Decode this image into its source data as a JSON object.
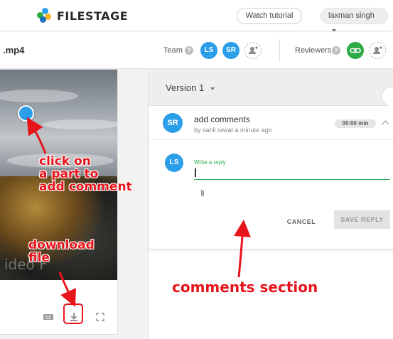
{
  "topbar": {
    "logo_text": "FILESTAGE",
    "watch_tutorial_label": "Watch tutorial",
    "user_name": "laxman singh"
  },
  "subheader": {
    "file_name": ".mp4",
    "team_label": "Team",
    "team_members": [
      "LS",
      "SR"
    ],
    "reviewers_label": "Reviewers"
  },
  "video": {
    "watermark": "ideo F"
  },
  "review": {
    "version_label": "Version 1",
    "comment": {
      "avatar": "SR",
      "title": "add comments",
      "meta": "by sahil rawat a minute ago",
      "timecode": "00:00 min"
    },
    "reply": {
      "avatar": "LS",
      "label": "Write a reply",
      "cancel_label": "CANCEL",
      "save_label": "SAVE REPLY"
    }
  },
  "annotations": {
    "click_line1": "click on",
    "click_line2": "a part to",
    "click_line3": "add comment",
    "download_line1": "download",
    "download_line2": "file",
    "comments_section": "comments section"
  },
  "colors": {
    "accent_blue": "#2a9ee8",
    "reviewer_green": "#2eaa47",
    "annotation_red": "#e8141c"
  }
}
